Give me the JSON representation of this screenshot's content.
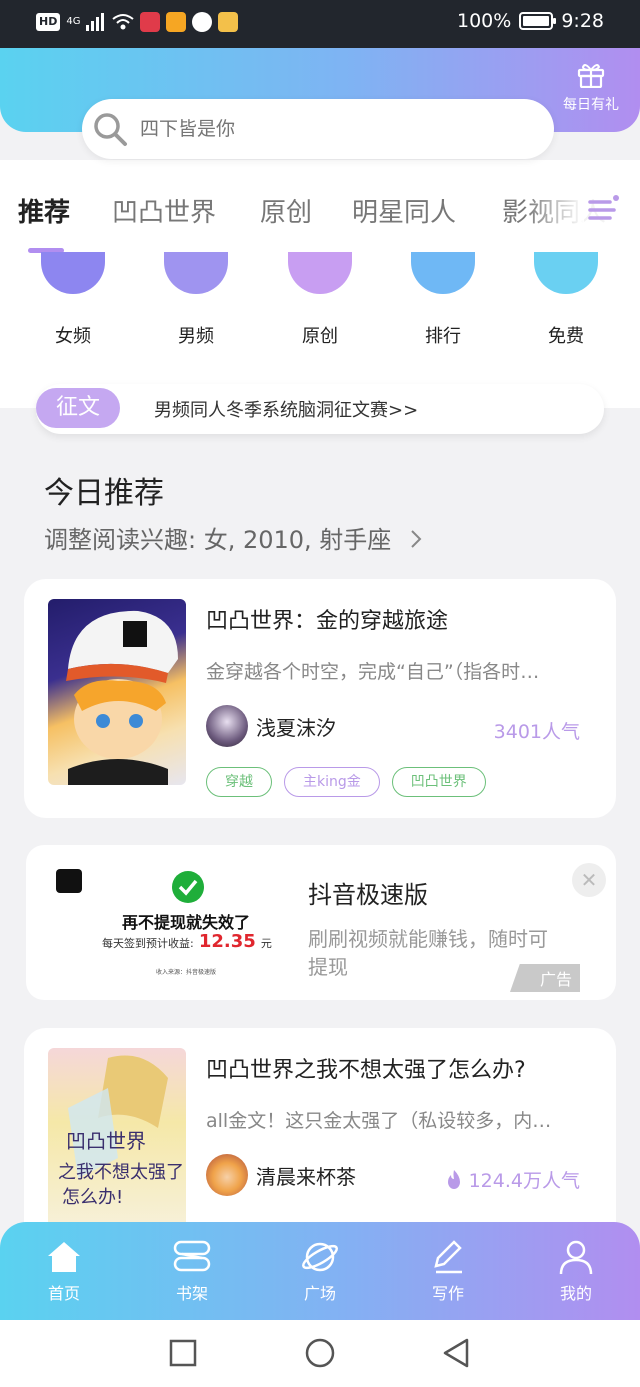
{
  "status_bar": {
    "net_badge": "HD",
    "signal_label": "4G",
    "battery": "100%",
    "time": "9:28"
  },
  "header": {
    "gift_label": "每日有礼",
    "search_placeholder": "四下皆是你"
  },
  "tabs": [
    "推荐",
    "凹凸世界",
    "原创",
    "明星同人",
    "影视同人"
  ],
  "categories": [
    {
      "label": "女频",
      "color": "#8d86f0"
    },
    {
      "label": "男频",
      "color": "#9f94f0"
    },
    {
      "label": "原创",
      "color": "#c89ef2"
    },
    {
      "label": "排行",
      "color": "#6fb8f5"
    },
    {
      "label": "免费",
      "color": "#6ad0f2"
    }
  ],
  "contest": {
    "tag": "征文",
    "text": "男频同人冬季系统脑洞征文赛>>"
  },
  "section": {
    "title": "今日推荐",
    "subtitle": "调整阅读兴趣: 女, 2010, 射手座"
  },
  "books": [
    {
      "title": "凹凸世界：金的穿越旅途",
      "desc": "金穿越各个时空，完成“自己”（指各时…",
      "author": "浅夏沫汐",
      "popularity": "3401人气",
      "tags": [
        {
          "label": "穿越",
          "color": "#6cc07a"
        },
        {
          "label": "主king金",
          "color": "#b99ae8"
        },
        {
          "label": "凹凸世界",
          "color": "#6cc07a"
        }
      ]
    },
    {
      "title": "凹凸世界之我不想太强了怎么办?",
      "desc": "all金文！这只金太强了（私设较多，内…",
      "author": "清晨来杯茶",
      "popularity": "124.4万人气",
      "tags": []
    }
  ],
  "ad": {
    "title": "抖音极速版",
    "desc": "刷刷视频就能赚钱，随时可提现",
    "badge": "广告",
    "close": "✕",
    "image_headline": "再不提现就失效了",
    "image_sub": "每天签到预计收益:",
    "image_amount": "12.35",
    "image_unit": "元",
    "image_source": "收入来源：抖音极速版"
  },
  "bottom_nav": [
    "首页",
    "书架",
    "广场",
    "写作",
    "我的"
  ]
}
